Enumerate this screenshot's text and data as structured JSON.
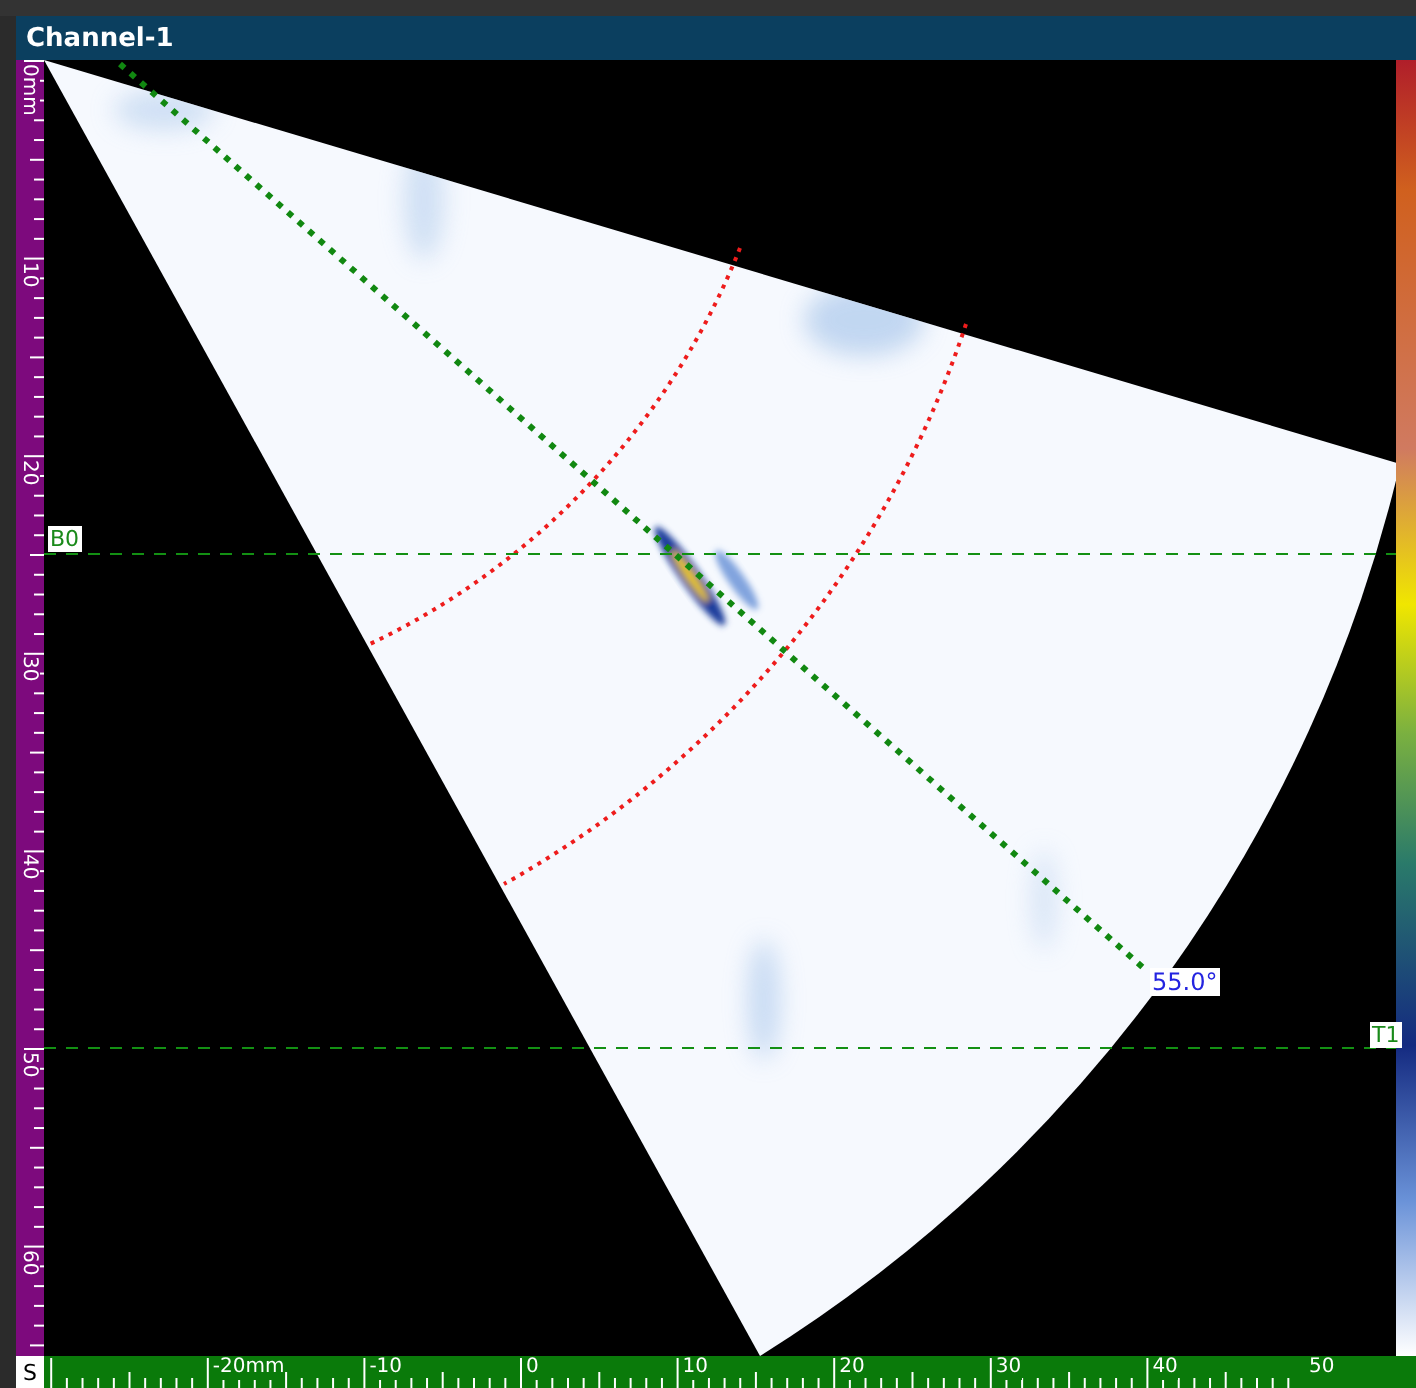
{
  "window": {
    "title": "Channel-1"
  },
  "depth_ruler": {
    "labels": [
      "0mm",
      "10",
      "20",
      "30",
      "40",
      "50",
      "60"
    ]
  },
  "index_ruler": {
    "origin_button": "S",
    "labels": [
      "-20mm",
      "-10",
      "0",
      "10",
      "20",
      "30",
      "40",
      "50"
    ]
  },
  "cursors": [
    {
      "label": "B0"
    },
    {
      "label": "T1"
    }
  ],
  "angle_label": "55.0°"
}
